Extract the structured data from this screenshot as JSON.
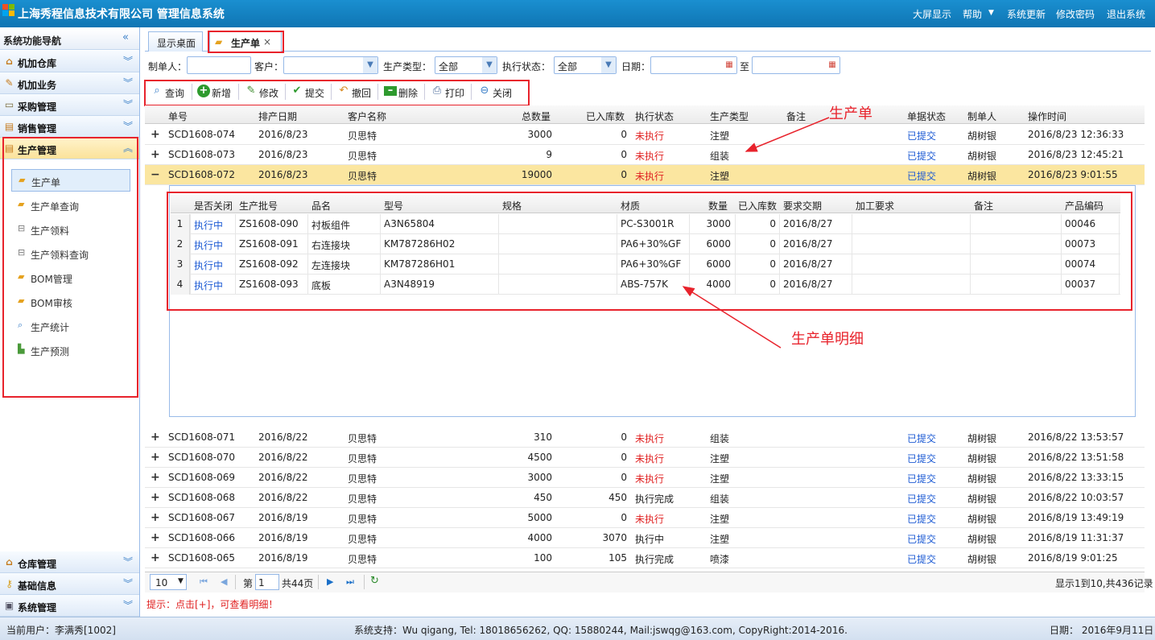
{
  "app": {
    "title": "上海秀程信息技术有限公司 管理信息系统",
    "links": [
      "大屏显示",
      "帮助",
      "系统更新",
      "修改密码",
      "退出系统"
    ]
  },
  "sidebar": {
    "title": "系统功能导航",
    "groups": [
      "机加仓库",
      "机加业务",
      "采购管理",
      "销售管理",
      "生产管理"
    ],
    "bottom_groups": [
      "仓库管理",
      "基础信息",
      "系统管理"
    ],
    "items": [
      "生产单",
      "生产单查询",
      "生产领料",
      "生产领料查询",
      "BOM管理",
      "BOM审核",
      "生产统计",
      "生产预测"
    ]
  },
  "tabs": {
    "home": "显示桌面",
    "active": "生产单",
    "close": "×"
  },
  "filters": {
    "creator": "制单人：",
    "customer": "客户：",
    "type": "生产类型：",
    "type_val": "全部",
    "status": "执行状态：",
    "status_val": "全部",
    "date": "日期：",
    "to": "至"
  },
  "toolbar": [
    "查询",
    "新增",
    "修改",
    "提交",
    "撤回",
    "删除",
    "打印",
    "关闭"
  ],
  "columns": [
    "单号",
    "排产日期",
    "客户名称",
    "总数量",
    "已入库数",
    "执行状态",
    "生产类型",
    "备注",
    "单据状态",
    "制单人",
    "操作时间"
  ],
  "rows_top": [
    [
      "SCD1608-074",
      "2016/8/23",
      "贝思特",
      "3000",
      "0",
      "未执行",
      "注塑",
      "",
      "已提交",
      "胡树银",
      "2016/8/23 12:36:33"
    ],
    [
      "SCD1608-073",
      "2016/8/23",
      "贝思特",
      "9",
      "0",
      "未执行",
      "组装",
      "",
      "已提交",
      "胡树银",
      "2016/8/23 12:45:21"
    ],
    [
      "SCD1608-072",
      "2016/8/23",
      "贝思特",
      "19000",
      "0",
      "未执行",
      "注塑",
      "",
      "已提交",
      "胡树银",
      "2016/8/23 9:01:55"
    ]
  ],
  "detail_columns": [
    "是否关闭",
    "生产批号",
    "品名",
    "型号",
    "规格",
    "材质",
    "数量",
    "已入库数",
    "要求交期",
    "加工要求",
    "备注",
    "产品编码"
  ],
  "detail_rows": [
    [
      "1",
      "执行中",
      "ZS1608-090",
      "衬板组件",
      "A3N65804",
      "",
      "PC-S3001R",
      "3000",
      "0",
      "2016/8/27",
      "",
      "",
      "00046"
    ],
    [
      "2",
      "执行中",
      "ZS1608-091",
      "右连接块",
      "KM787286H02",
      "",
      "PA6+30%GF",
      "6000",
      "0",
      "2016/8/27",
      "",
      "",
      "00073"
    ],
    [
      "3",
      "执行中",
      "ZS1608-092",
      "左连接块",
      "KM787286H01",
      "",
      "PA6+30%GF",
      "6000",
      "0",
      "2016/8/27",
      "",
      "",
      "00074"
    ],
    [
      "4",
      "执行中",
      "ZS1608-093",
      "底板",
      "A3N48919",
      "",
      "ABS-757K",
      "4000",
      "0",
      "2016/8/27",
      "",
      "",
      "00037"
    ]
  ],
  "rows_bottom": [
    [
      "SCD1608-071",
      "2016/8/22",
      "贝思特",
      "310",
      "0",
      "未执行",
      "组装",
      "",
      "已提交",
      "胡树银",
      "2016/8/22 13:53:57"
    ],
    [
      "SCD1608-070",
      "2016/8/22",
      "贝思特",
      "4500",
      "0",
      "未执行",
      "注塑",
      "",
      "已提交",
      "胡树银",
      "2016/8/22 13:51:58"
    ],
    [
      "SCD1608-069",
      "2016/8/22",
      "贝思特",
      "3000",
      "0",
      "未执行",
      "注塑",
      "",
      "已提交",
      "胡树银",
      "2016/8/22 13:33:15"
    ],
    [
      "SCD1608-068",
      "2016/8/22",
      "贝思特",
      "450",
      "450",
      "执行完成",
      "组装",
      "",
      "已提交",
      "胡树银",
      "2016/8/22 10:03:57"
    ],
    [
      "SCD1608-067",
      "2016/8/19",
      "贝思特",
      "5000",
      "0",
      "未执行",
      "注塑",
      "",
      "已提交",
      "胡树银",
      "2016/8/19 13:49:19"
    ],
    [
      "SCD1608-066",
      "2016/8/19",
      "贝思特",
      "4000",
      "3070",
      "执行中",
      "注塑",
      "",
      "已提交",
      "胡树银",
      "2016/8/19 11:31:37"
    ],
    [
      "SCD1608-065",
      "2016/8/19",
      "贝思特",
      "100",
      "105",
      "执行完成",
      "喷漆",
      "",
      "已提交",
      "胡树银",
      "2016/8/19 9:01:25"
    ]
  ],
  "pager": {
    "size": "10",
    "page_prefix": "第",
    "page": "1",
    "total_pages": "共44页",
    "summary": "显示1到10,共436记录"
  },
  "hint": "提示：点击[+]，可查看明细！",
  "footer": {
    "user": "当前用户：李满秀[1002]",
    "support": "系统支持：Wu qigang, Tel: 18018656262, QQ: 15880244, Mail:jswqg@163.com, CopyRight:2014-2016.",
    "date": "日期： 2016年9月11日"
  },
  "annotations": {
    "order": "生产单",
    "detail": "生产单明细"
  }
}
